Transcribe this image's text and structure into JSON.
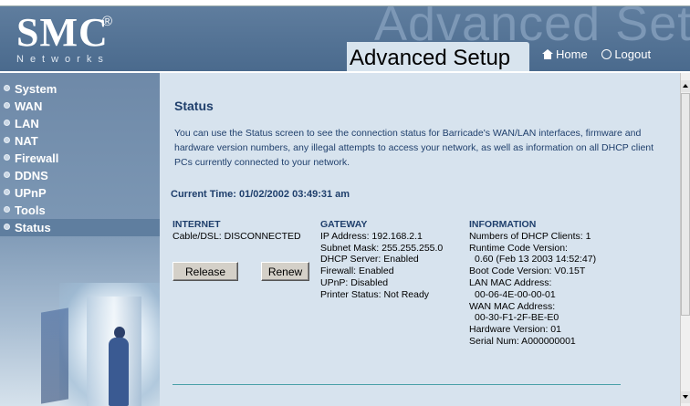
{
  "header": {
    "logo": "SMC",
    "logo_reg": "®",
    "logo_sub": "Networks",
    "watermark": "Advanced Setup",
    "title": "Advanced Setup",
    "home_label": "Home",
    "logout_label": "Logout"
  },
  "sidebar": {
    "items": [
      {
        "label": "System"
      },
      {
        "label": "WAN"
      },
      {
        "label": "LAN"
      },
      {
        "label": "NAT"
      },
      {
        "label": "Firewall"
      },
      {
        "label": "DDNS"
      },
      {
        "label": "UPnP"
      },
      {
        "label": "Tools"
      },
      {
        "label": "Status",
        "active": true
      }
    ]
  },
  "main": {
    "heading": "Status",
    "intro": "You can use the Status screen to see the connection status for Barricade's WAN/LAN interfaces, firmware and hardware version numbers, any illegal attempts to access your network, as well as information on all DHCP client PCs currently connected to your network.",
    "current_time": "Current Time: 01/02/2002 03:49:31 am",
    "internet": {
      "heading": "INTERNET",
      "cable_dsl": "Cable/DSL:  DISCONNECTED",
      "release_label": "Release",
      "renew_label": "Renew"
    },
    "gateway": {
      "heading": "GATEWAY",
      "ip": "IP Address:  192.168.2.1",
      "subnet": "Subnet Mask:  255.255.255.0",
      "dhcp": "DHCP Server:  Enabled",
      "firewall": "Firewall:  Enabled",
      "upnp": "UPnP:  Disabled",
      "printer": "Printer Status: Not Ready"
    },
    "information": {
      "heading": "INFORMATION",
      "dhcp_clients": "Numbers of DHCP Clients:  1",
      "runtime_label": "Runtime Code Version:",
      "runtime_value": "0.60 (Feb 13 2003 14:52:47)",
      "boot": "Boot Code Version:  V0.15T",
      "lan_mac_label": "LAN MAC Address:",
      "lan_mac_value": "00-06-4E-00-00-01",
      "wan_mac_label": "WAN MAC Address:",
      "wan_mac_value": "00-30-F1-2F-BE-E0",
      "hardware": "Hardware Version:  01",
      "serial": "Serial Num:   A000000001"
    }
  },
  "colors": {
    "header_blue": "#4a6a8d",
    "content_bg": "#d7e3ee",
    "heading_text": "#1f3f6c",
    "rule": "#4aa0a8"
  }
}
